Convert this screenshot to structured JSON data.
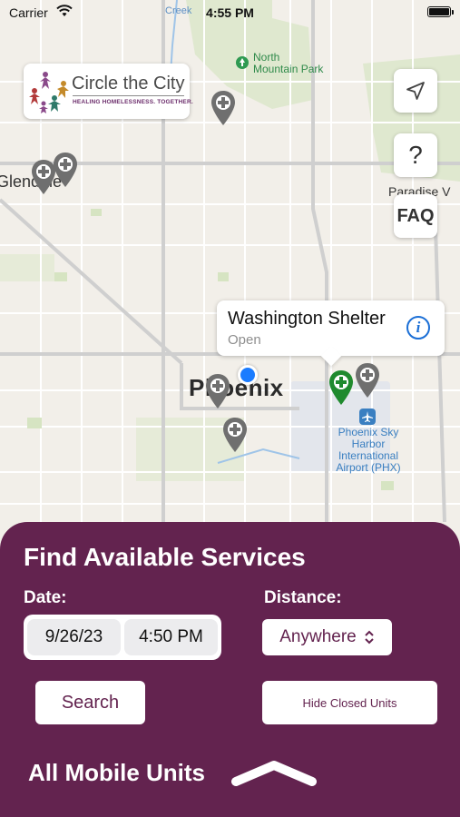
{
  "status_bar": {
    "carrier": "Carrier",
    "time": "4:55 PM"
  },
  "logo": {
    "title": "Circle the City",
    "tagline": "HEALING HOMELESSNESS. TOGETHER."
  },
  "map": {
    "labels": {
      "north_mountain_park": "North\nMountain Park",
      "glendale": "Glendale",
      "paradise_valley": "Paradise V",
      "phoenix": "Phoenix",
      "airport": "Phoenix Sky\nHarbor\nInternational\nAirport (PHX)",
      "creek": "Creek"
    },
    "buttons": {
      "locate_icon": "location-arrow-icon",
      "help_label": "?",
      "faq_label": "FAQ"
    },
    "selected_pin_color": "#1f8a2e",
    "pin_color": "#6f6f6f",
    "user_location_color": "#1a7cff"
  },
  "callout": {
    "title": "Washington Shelter",
    "status": "Open",
    "info_icon": "info-icon"
  },
  "panel": {
    "title": "Find Available Services",
    "date_label": "Date:",
    "distance_label": "Distance:",
    "date_value": "9/26/23",
    "time_value": "4:50 PM",
    "distance_value": "Anywhere",
    "search_label": "Search",
    "hide_closed_label": "Hide Closed Units",
    "mobile_units_label": "All Mobile Units",
    "background_color": "#63234f"
  }
}
